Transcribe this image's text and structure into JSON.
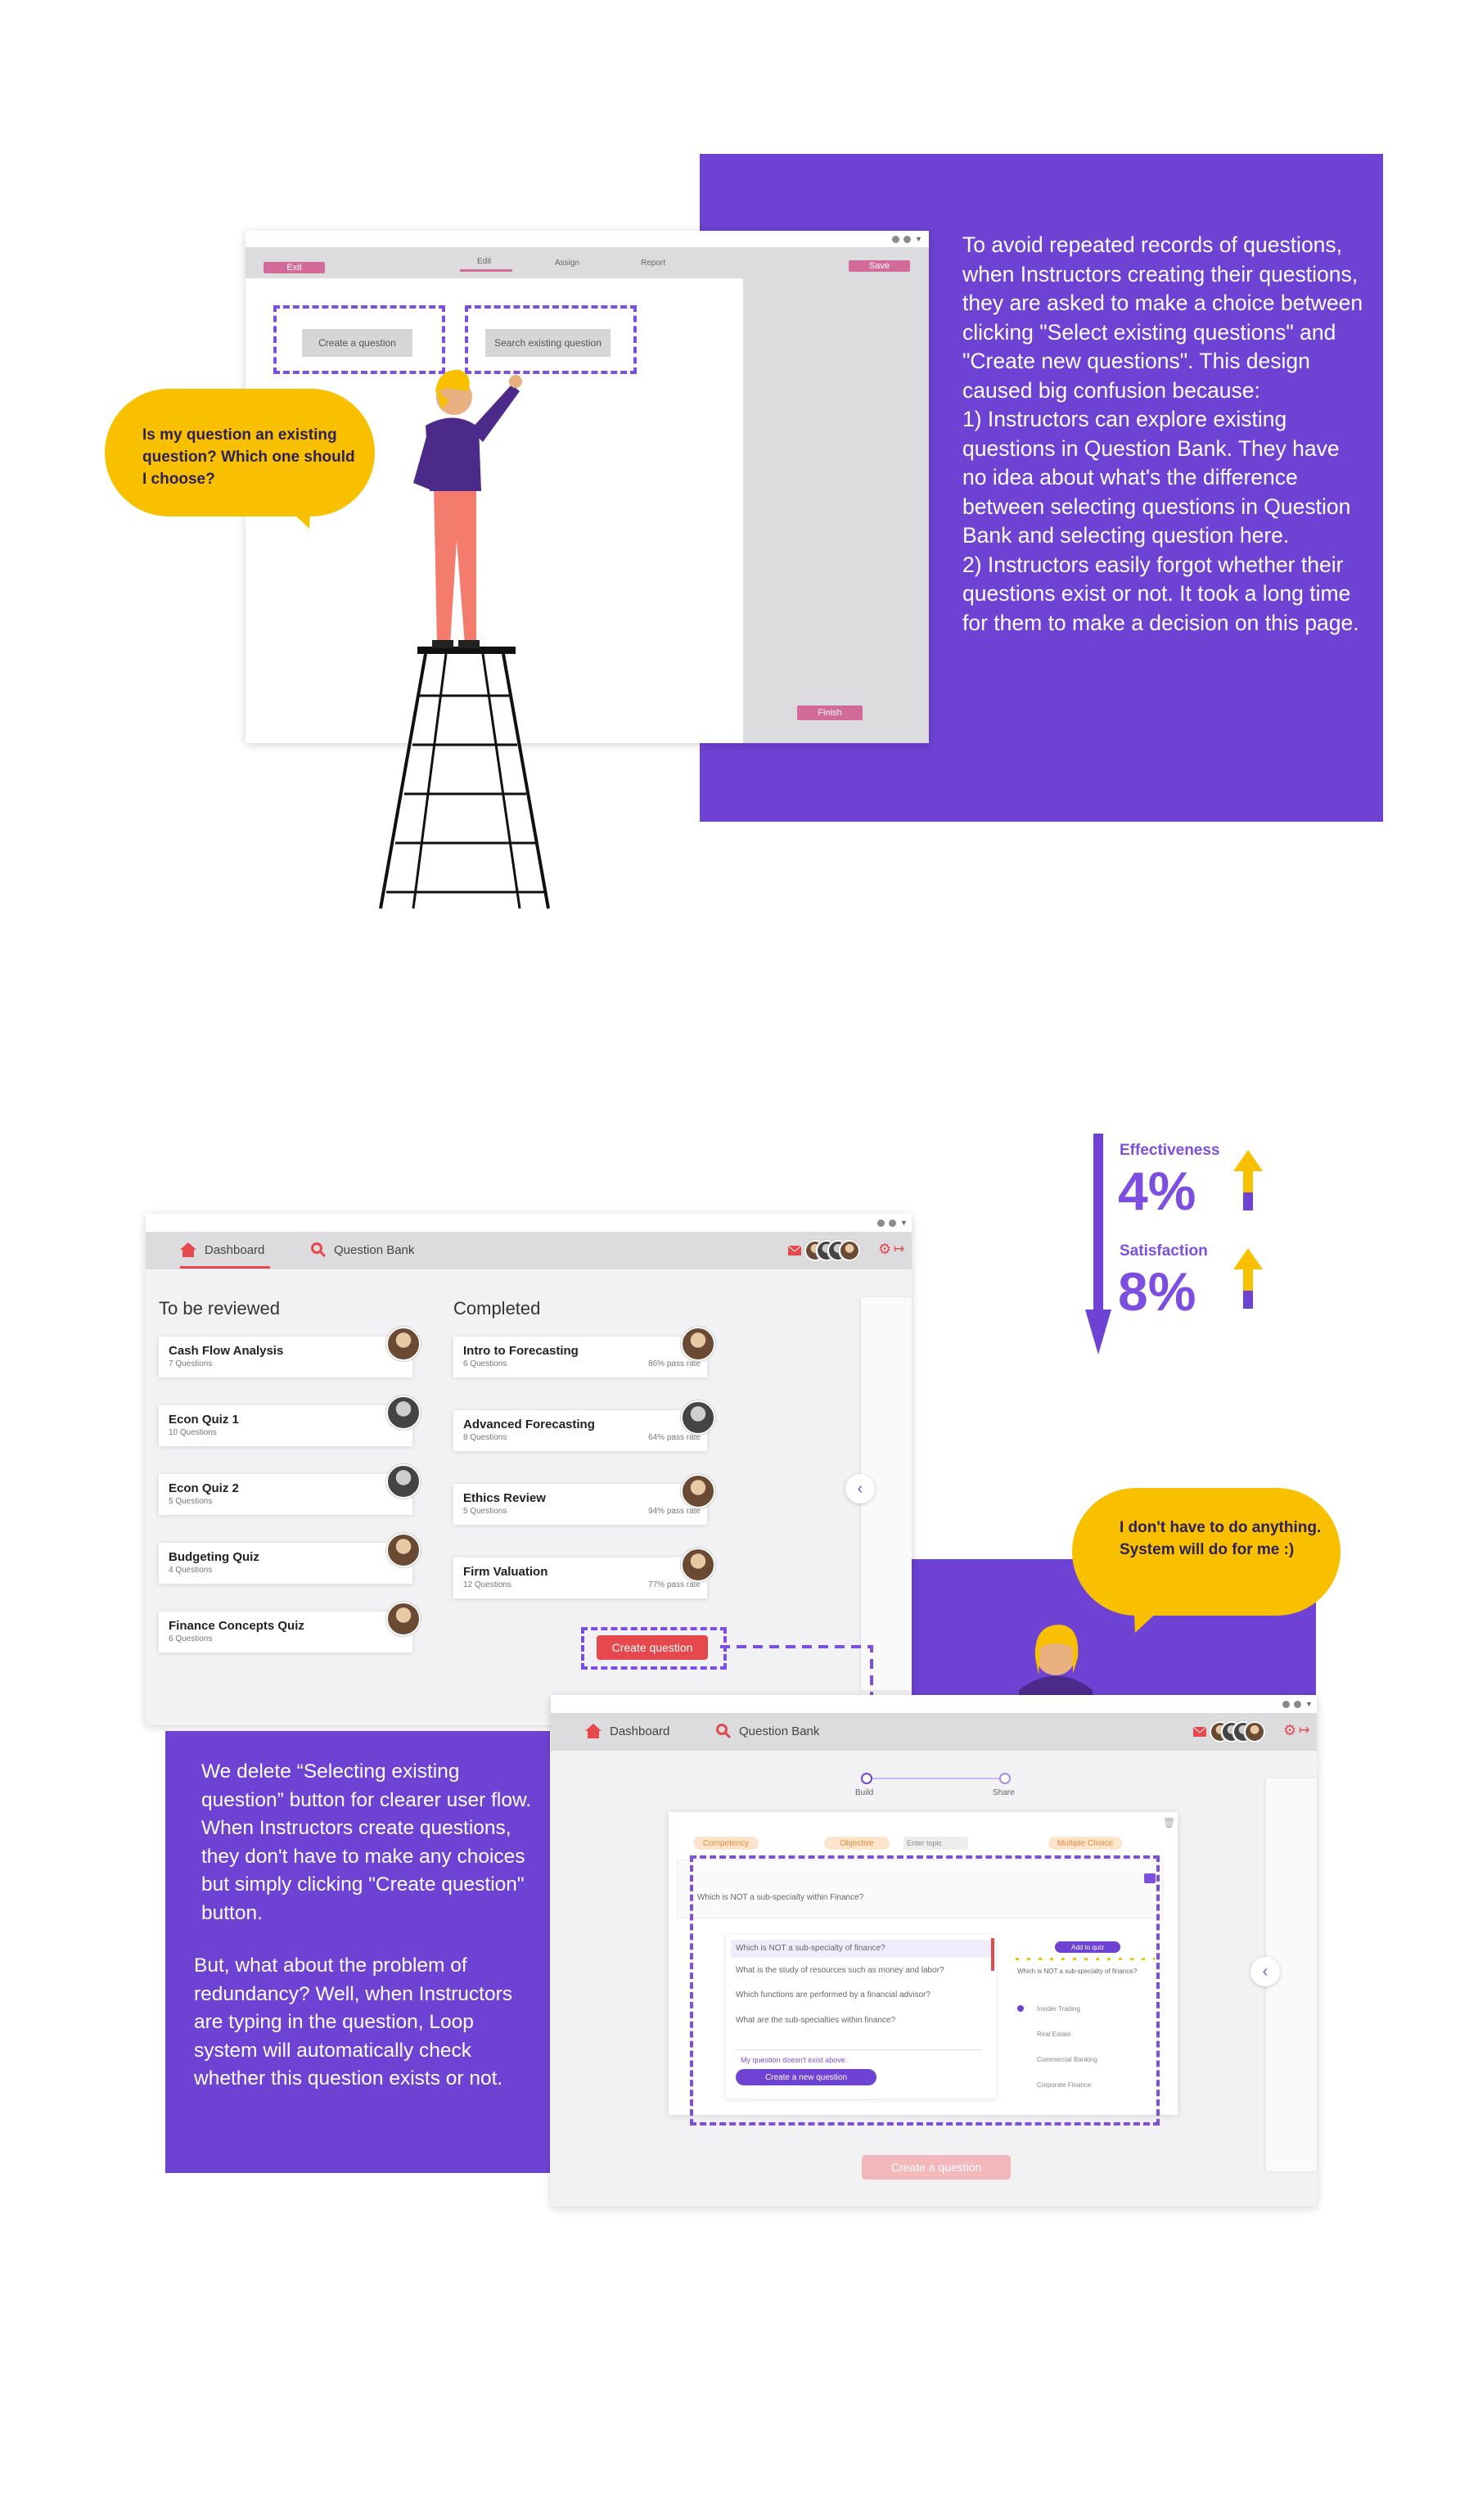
{
  "section1": {
    "editor": {
      "exit_label": "Exit",
      "tabs": [
        "Edit",
        "Assign",
        "Report"
      ],
      "save_label": "Save",
      "create_label": "Create a question",
      "search_label": "Search existing question",
      "finish_label": "Finish"
    },
    "bubble_text": "Is my question an existing question? Which one should I choose?",
    "description": "To avoid repeated records of questions, when Instructors creating their questions, they are asked to make a choice between clicking \"Select existing questions\" and \"Create new questions\". This design caused big confusion because:\n1) Instructors can explore existing questions in Question Bank. They have no idea about what's the difference between selecting questions in Question Bank and selecting question here.\n2) Instructors easily forgot whether their questions exist or not. It took a long time for them to make a decision on this page."
  },
  "metrics": [
    {
      "label": "Effectiveness",
      "value": "4%"
    },
    {
      "label": "Satisfaction",
      "value": "8%"
    }
  ],
  "dashboard": {
    "nav_dashboard": "Dashboard",
    "nav_question_bank": "Question Bank",
    "to_review_heading": "To be reviewed",
    "completed_heading": "Completed",
    "to_review": [
      {
        "title": "Cash Flow Analysis",
        "sub": "7 Questions"
      },
      {
        "title": "Econ Quiz 1",
        "sub": "10 Questions"
      },
      {
        "title": "Econ Quiz 2",
        "sub": "5 Questions"
      },
      {
        "title": "Budgeting Quiz",
        "sub": "4 Questions"
      },
      {
        "title": "Finance Concepts Quiz",
        "sub": "6 Questions"
      }
    ],
    "completed": [
      {
        "title": "Intro to Forecasting",
        "sub": "6 Questions",
        "rate": "86% pass rate"
      },
      {
        "title": "Advanced Forecasting",
        "sub": "8 Questions",
        "rate": "64% pass rate"
      },
      {
        "title": "Ethics Review",
        "sub": "5 Questions",
        "rate": "94% pass rate"
      },
      {
        "title": "Firm Valuation",
        "sub": "12 Questions",
        "rate": "77% pass rate"
      }
    ],
    "create_button": "Create question"
  },
  "bubble2_text": "I don't have to do anything. System will do for me  :)",
  "solution_text1": "We delete “Selecting existing question” button for clearer user flow. When Instructors create questions, they don't have to make any choices but simply clicking \"Create question\" button.",
  "solution_text2": "But, what about the problem of redundancy? Well, when Instructors are typing in the question, Loop system will automatically check whether this question exists or not.",
  "builder": {
    "nav_dashboard": "Dashboard",
    "nav_question_bank": "Question Bank",
    "steps": [
      "Build",
      "Share"
    ],
    "tags": [
      "Competency",
      "Objective",
      "Enter topic",
      "Multiple Choice"
    ],
    "question_text": "Which is NOT a sub-specialty within Finance?",
    "suggestions": [
      "Which is NOT a sub-specialty of finance?",
      "What is the study of resources such as money and labor?",
      "Which functions are performed by a financial advisor?",
      "What are the sub-specialties within finance?"
    ],
    "not_exist_text": "My question doesn't exist above.",
    "create_new_label": "Create a new question",
    "add_to_quiz": "Add to quiz",
    "preview_question": "Which is NOT a sub-specialty of finance?",
    "preview_options": [
      "Insider Trading",
      "Real Estate",
      "Commercial Banking",
      "Corporate Finance"
    ],
    "create_button": "Create a question"
  }
}
